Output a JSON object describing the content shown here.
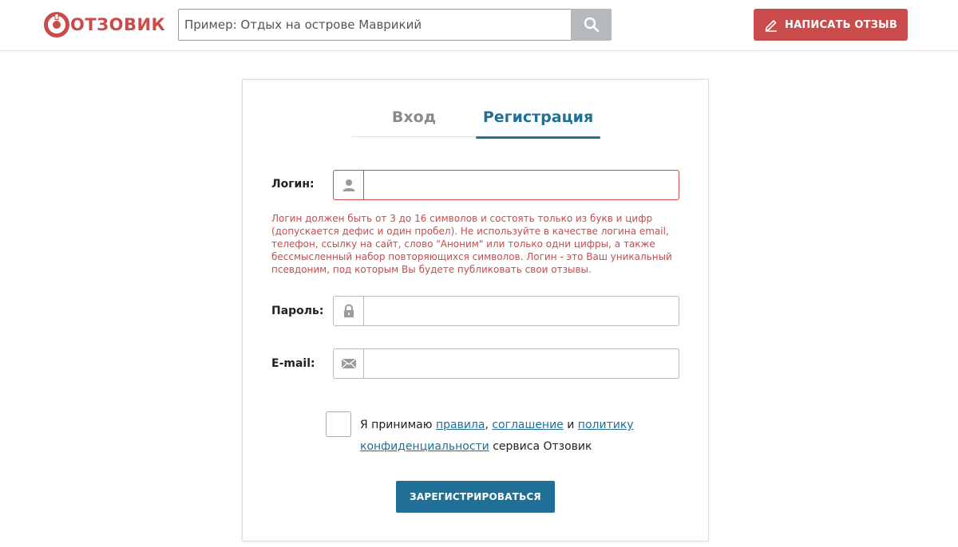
{
  "header": {
    "logo_text": "ОТЗОВИК",
    "search_placeholder": "Пример: Отдых на острове Маврикий",
    "write_review_label": "НАПИСАТЬ ОТЗЫВ",
    "brand_color": "#c94b4b"
  },
  "auth": {
    "tabs": [
      {
        "label": "Вход",
        "active": false
      },
      {
        "label": "Регистрация",
        "active": true
      }
    ],
    "fields": {
      "login_label": "Логин:",
      "login_value": "",
      "login_icon": "user-icon",
      "login_error": "Логин должен быть от 3 до 16 символов и состоять только из букв и цифр (допускается дефис и один пробел). Не используйте в качестве логина email, телефон, ссылку на сайт, слово \"Аноним\" или только одни цифры, а также бессмысленный набор повторяющихся символов. Логин - это Ваш уникальный псевдоним, под которым Вы будете публиковать свои отзывы.",
      "password_label": "Пароль:",
      "password_value": "",
      "password_icon": "lock-icon",
      "email_label": "E-mail:",
      "email_value": "",
      "email_icon": "envelope-icon"
    },
    "agreement": {
      "prefix": "Я принимаю ",
      "link_rules": "правила",
      "sep1": ", ",
      "link_agreement": "соглашение",
      "sep2": " и ",
      "link_policy": "политику конфиденциальности",
      "suffix": " сервиса Отзовик",
      "checked": false
    },
    "submit_label": "ЗАРЕГИСТРИРОВАТЬСЯ",
    "accent_color": "#1f6f97",
    "error_color": "#c94b4b"
  }
}
